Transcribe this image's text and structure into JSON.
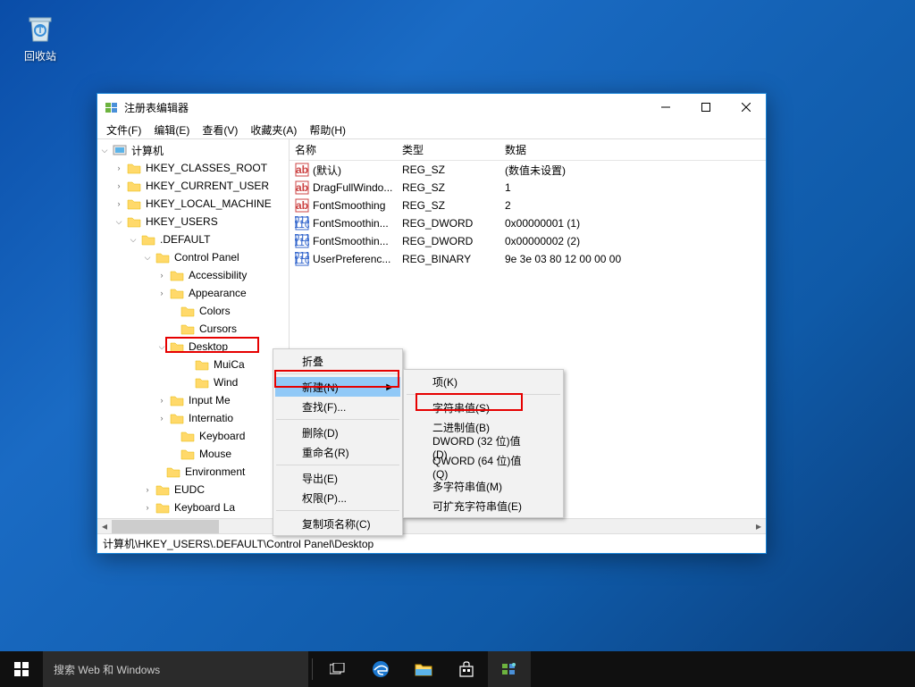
{
  "desktop": {
    "recycle_bin": "回收站"
  },
  "window": {
    "title": "注册表编辑器",
    "menu": {
      "file": "文件(F)",
      "edit": "编辑(E)",
      "view": "查看(V)",
      "favorites": "收藏夹(A)",
      "help": "帮助(H)"
    },
    "tree": {
      "root": "计算机",
      "hkcr": "HKEY_CLASSES_ROOT",
      "hkcu": "HKEY_CURRENT_USER",
      "hklm": "HKEY_LOCAL_MACHINE",
      "hku": "HKEY_USERS",
      "default": ".DEFAULT",
      "control_panel": "Control Panel",
      "accessibility": "Accessibility",
      "appearance": "Appearance",
      "colors": "Colors",
      "cursors": "Cursors",
      "desktop": "Desktop",
      "muicached": "MuiCa",
      "windowmetrics": "Wind",
      "input_method": "Input Me",
      "international": "Internatio",
      "keyboard": "Keyboard",
      "mouse": "Mouse",
      "environment": "Environment",
      "eudc": "EUDC",
      "keyboard_layout": "Keyboard La"
    },
    "list": {
      "headers": {
        "name": "名称",
        "type": "类型",
        "data": "数据"
      },
      "rows": [
        {
          "name": "(默认)",
          "type": "REG_SZ",
          "data": "(数值未设置)",
          "icon": "ab"
        },
        {
          "name": "DragFullWindo...",
          "type": "REG_SZ",
          "data": "1",
          "icon": "ab"
        },
        {
          "name": "FontSmoothing",
          "type": "REG_SZ",
          "data": "2",
          "icon": "ab"
        },
        {
          "name": "FontSmoothin...",
          "type": "REG_DWORD",
          "data": "0x00000001 (1)",
          "icon": "bin"
        },
        {
          "name": "FontSmoothin...",
          "type": "REG_DWORD",
          "data": "0x00000002 (2)",
          "icon": "bin"
        },
        {
          "name": "UserPreferenc...",
          "type": "REG_BINARY",
          "data": "9e 3e 03 80 12 00 00 00",
          "icon": "bin"
        }
      ]
    },
    "statusbar": "计算机\\HKEY_USERS\\.DEFAULT\\Control Panel\\Desktop"
  },
  "context1": {
    "collapse": "折叠",
    "new": "新建(N)",
    "find": "查找(F)...",
    "delete": "删除(D)",
    "rename": "重命名(R)",
    "export": "导出(E)",
    "permissions": "权限(P)...",
    "copy_key": "复制项名称(C)"
  },
  "context2": {
    "key": "项(K)",
    "string": "字符串值(S)",
    "binary": "二进制值(B)",
    "dword": "DWORD (32 位)值(D)",
    "qword": "QWORD (64 位)值(Q)",
    "multi_string": "多字符串值(M)",
    "expand_string": "可扩充字符串值(E)"
  },
  "taskbar": {
    "search_placeholder": "搜索 Web 和 Windows"
  }
}
